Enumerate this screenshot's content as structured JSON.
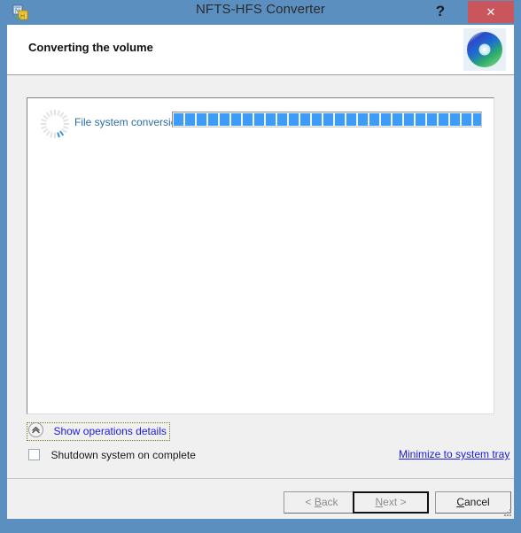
{
  "window": {
    "title": "NFTS-HFS Converter",
    "app_icon": "converter-app-icon",
    "help_glyph": "?",
    "close_glyph": "✕",
    "frame_color": "#5b8fc0",
    "close_color": "#c9565c"
  },
  "header": {
    "title": "Converting the volume",
    "logo": "disc-brand-logo"
  },
  "progress_panel": {
    "spinner": "loading-spinner-icon",
    "task_label": "File system conversion",
    "progress": {
      "segments_total": 28,
      "segments_filled": 28,
      "percent": 100,
      "bar_color": "#3d9bfa"
    }
  },
  "options": {
    "toggle_details_label": "Show operations details",
    "toggle_details_icon": "chevron-up-icon",
    "shutdown_label": "Shutdown system on complete",
    "shutdown_checked": false,
    "tray_link_label": "Minimize to system tray"
  },
  "buttons": {
    "back": {
      "pre": "< ",
      "mnemonic": "B",
      "post": "ack",
      "disabled": true
    },
    "next": {
      "pre": "",
      "mnemonic": "N",
      "post": "ext >",
      "disabled": true,
      "default": true
    },
    "cancel": {
      "pre": "",
      "mnemonic": "C",
      "post": "ancel",
      "disabled": false
    }
  }
}
